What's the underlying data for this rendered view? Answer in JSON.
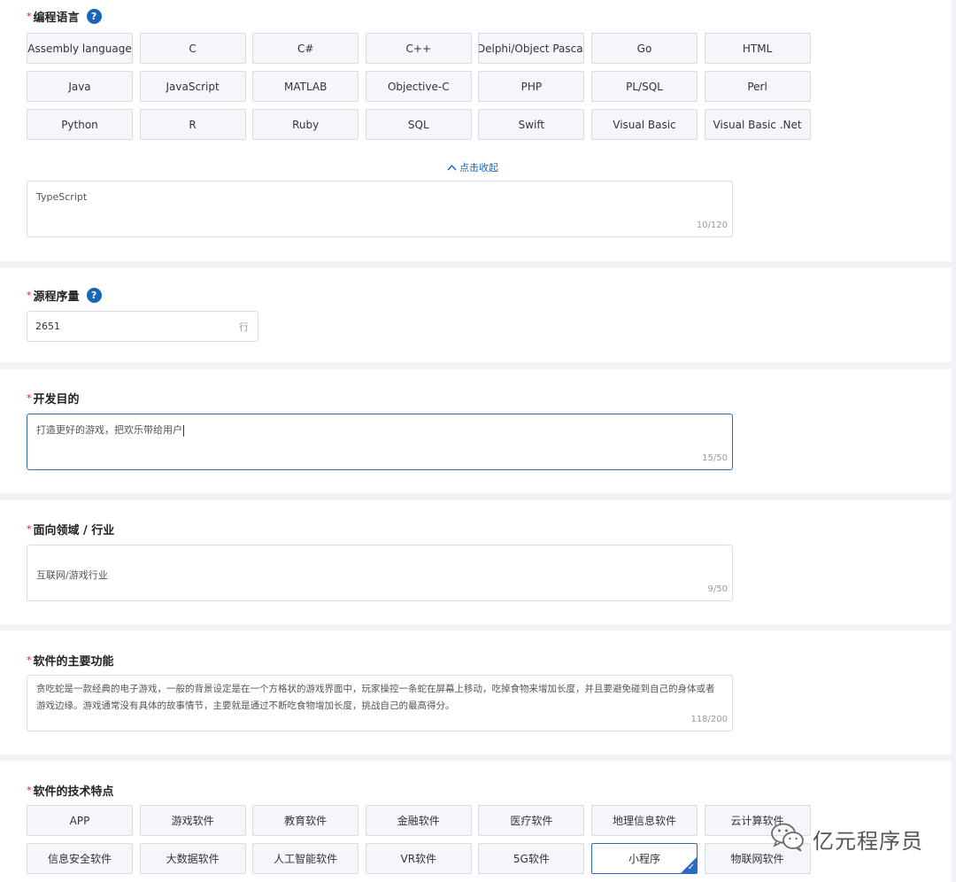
{
  "language": {
    "label": "编程语言",
    "help": "?",
    "options": [
      "Assembly language",
      "C",
      "C#",
      "C++",
      "Delphi/Object Pascal",
      "Go",
      "HTML",
      "Java",
      "JavaScript",
      "MATLAB",
      "Objective-C",
      "PHP",
      "PL/SQL",
      "Perl",
      "Python",
      "R",
      "Ruby",
      "SQL",
      "Swift",
      "Visual Basic",
      "Visual Basic .Net"
    ],
    "collapse_label": "点击收起",
    "other_value": "TypeScript",
    "other_counter": "10/120"
  },
  "source_lines": {
    "label": "源程序量",
    "help": "?",
    "value": "2651",
    "unit": "行"
  },
  "purpose": {
    "label": "开发目的",
    "value": "打造更好的游戏，把欢乐带给用户",
    "counter": "15/50"
  },
  "domain": {
    "label": "面向领域 / 行业",
    "value": "互联网/游戏行业",
    "counter": "9/50"
  },
  "features": {
    "label": "软件的主要功能",
    "value": "贪吃蛇是一款经典的电子游戏，一般的背景设定是在一个方格状的游戏界面中，玩家操控一条蛇在屏幕上移动，吃掉食物来增加长度，并且要避免碰到自己的身体或者游戏边缘。游戏通常没有具体的故事情节，主要就是通过不断吃食物增加长度，挑战自己的最高得分。",
    "counter": "118/200"
  },
  "tech": {
    "label": "软件的技术特点",
    "options": [
      "APP",
      "游戏软件",
      "教育软件",
      "金融软件",
      "医疗软件",
      "地理信息软件",
      "云计算软件",
      "信息安全软件",
      "大数据软件",
      "人工智能软件",
      "VR软件",
      "5G软件",
      "小程序",
      "物联网软件"
    ],
    "selected": "小程序"
  },
  "watermark": {
    "text": "亿元程序员",
    "icon": "wechat-icon"
  },
  "colors": {
    "accent": "#1b65b9",
    "required": "#e02020",
    "chip_bg": "#f4f6f9",
    "page_bg": "#f0f2f5"
  }
}
